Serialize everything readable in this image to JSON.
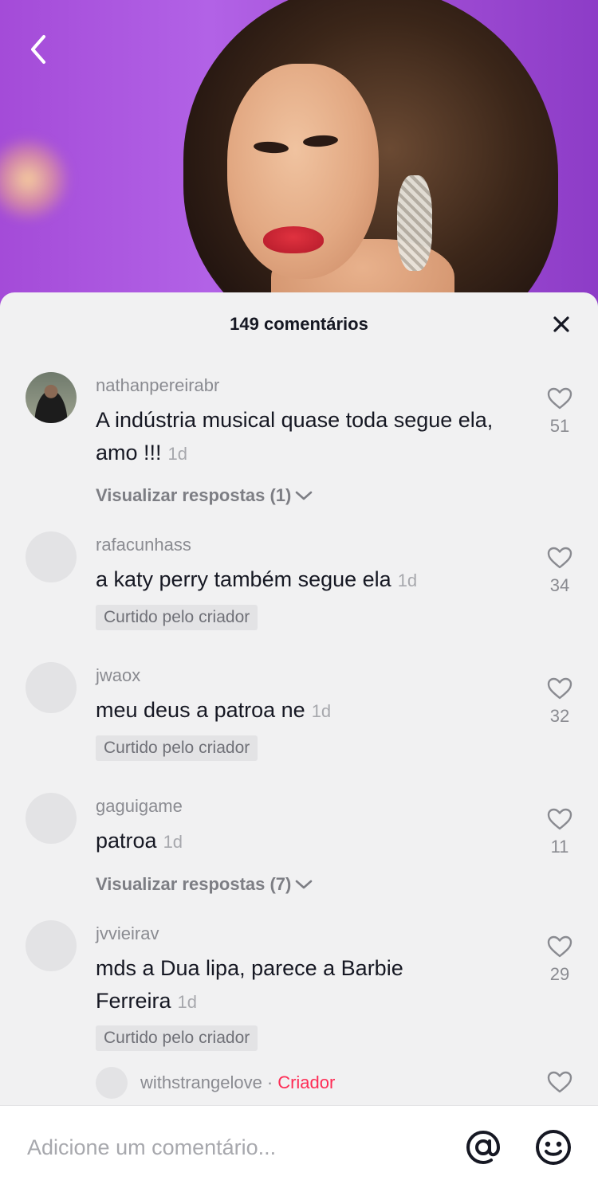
{
  "header": {
    "back_icon": "chevron-left-icon"
  },
  "sheet": {
    "title": "149 comentários",
    "close_icon": "close-icon"
  },
  "comments": [
    {
      "username": "nathanpereirabr",
      "text": "A indústria musical quase toda segue ela, amo !!!",
      "time": "1d",
      "likes": "51",
      "replies": "Visualizar respostas (1)"
    },
    {
      "username": "rafacunhass",
      "text": "a katy perry também segue ela",
      "time": "1d",
      "likes": "34",
      "badge": "Curtido pelo criador"
    },
    {
      "username": "jwaox",
      "text": "meu deus a patroa ne",
      "time": "1d",
      "likes": "32",
      "badge": "Curtido pelo criador"
    },
    {
      "username": "gaguigame",
      "text": "patroa",
      "time": "1d",
      "likes": "11",
      "replies": "Visualizar respostas (7)"
    },
    {
      "username": "jvvieirav",
      "text": "mds a Dua lipa, parece a Barbie Ferreira",
      "time": "1d",
      "likes": "29",
      "badge": "Curtido pelo criador"
    }
  ],
  "reply": {
    "username": "withstrangelove",
    "separator": "·",
    "creator_label": "Criador"
  },
  "input": {
    "placeholder": "Adicione um comentário...",
    "mention_icon": "at-sign-icon",
    "emoji_icon": "emoji-icon"
  },
  "colors": {
    "creator_accent": "#fe2c55",
    "sheet_background": "#f1f1f2",
    "hero_purple": "#a44bd8"
  }
}
